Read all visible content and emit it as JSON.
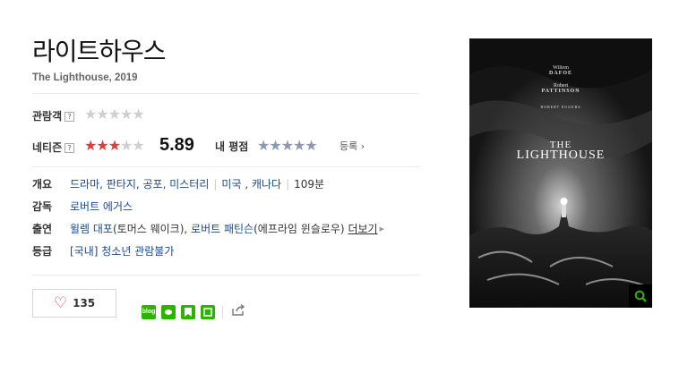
{
  "movie": {
    "title_kr": "라이트하우스",
    "title_en": "The Lighthouse, 2019"
  },
  "ratings": {
    "audience_label": "관람객",
    "audience_stars": 0,
    "netizen_label": "네티즌",
    "netizen_stars": 3,
    "netizen_score": "5.89",
    "my_rating_label": "내 평점",
    "register_label": "등록",
    "help_mark": "?"
  },
  "info": {
    "overview_label": "개요",
    "genres": "드라마, 판타지, 공포, 미스터리",
    "countries": "미국 , 캐나다",
    "runtime": "109분",
    "director_label": "감독",
    "director": "로버트 에거스",
    "cast_label": "출연",
    "cast1_name": "윌렘 대포",
    "cast1_role": "(토머스 웨이크), ",
    "cast2_name": "로버트 패틴슨",
    "cast2_role": "(에프라임 윈슬로우)",
    "more_label": "더보기",
    "rating_label": "등급",
    "rating_value": "[국내] 청소년 관람불가"
  },
  "like": {
    "count": "135"
  },
  "share": {
    "icons": [
      "blog-icon",
      "cafe-icon",
      "band-icon",
      "line-icon"
    ],
    "blog_text": "blog"
  },
  "poster": {
    "actor1_first": "Willem",
    "actor1_last": "DAFOE",
    "actor2_first": "Robert",
    "actor2_last": "PATTINSON",
    "director_by": "ROBERT EGGERS",
    "title_the": "THE",
    "title_main": "LIGHTHOUSE"
  },
  "colors": {
    "star_red": "#e33b3b",
    "link_blue": "#1c4a8a",
    "naver_green": "#2db400"
  }
}
